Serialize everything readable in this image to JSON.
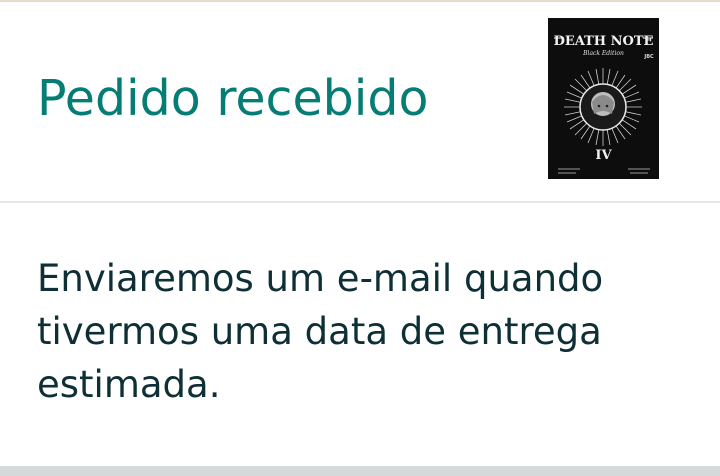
{
  "header": {
    "title": "Pedido recebido"
  },
  "product": {
    "icon": "manga-cover-image",
    "cover_title": "DEATH NOTE",
    "cover_subtitle": "Black Edition",
    "cover_volume": "IV",
    "cover_publisher": "JBC"
  },
  "message": {
    "text": "Enviaremos um e-mail quando tivermos uma data de entrega estimada."
  },
  "colors": {
    "title": "#057d75",
    "message": "#0e2f35",
    "divider": "#e6e6e6",
    "bottom_bar": "#d5d9d9"
  }
}
